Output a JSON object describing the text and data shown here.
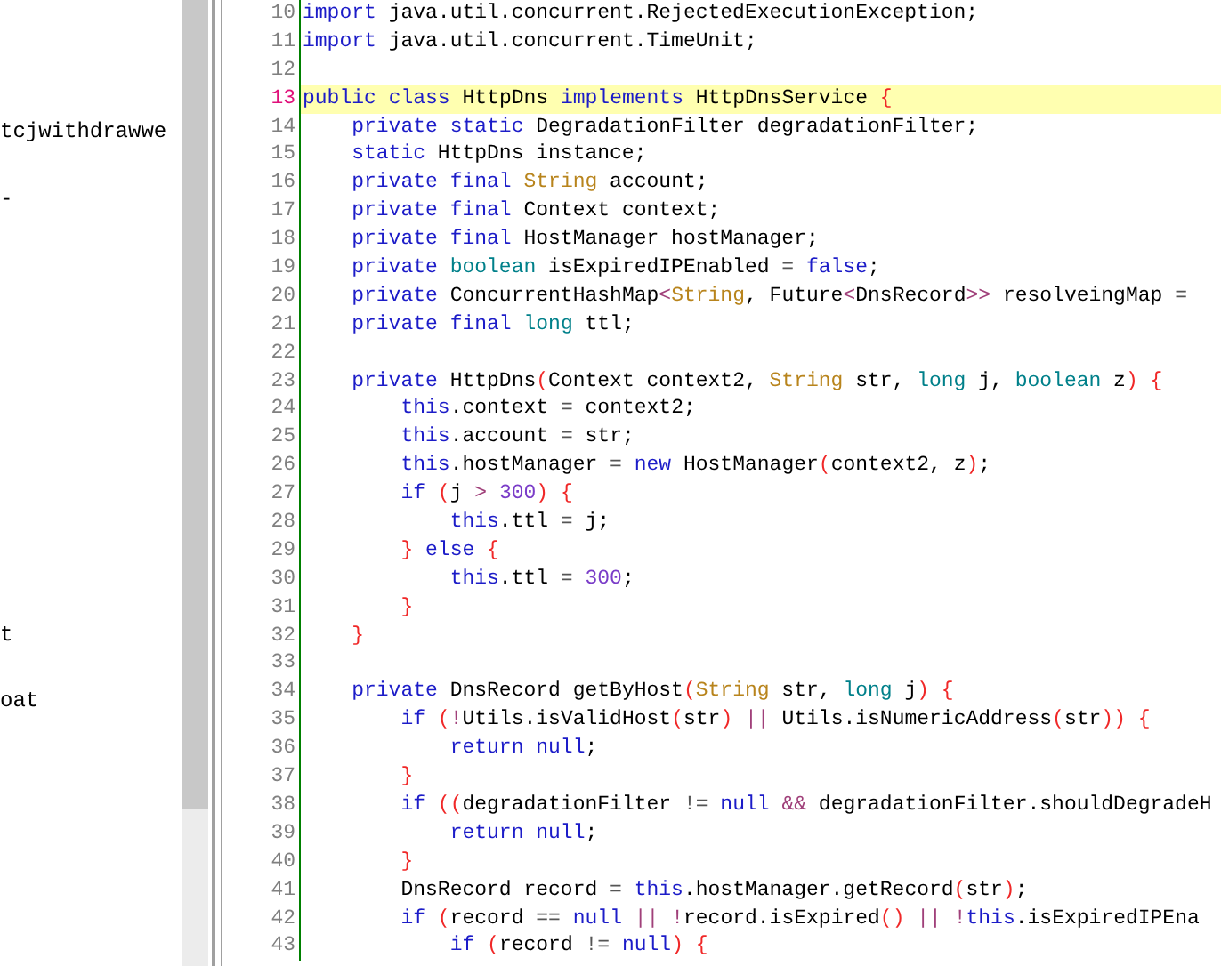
{
  "sidebar": {
    "items": [
      "tcjwithdrawwe",
      "-",
      "t",
      "oat"
    ]
  },
  "editor": {
    "lines": [
      {
        "number": "10",
        "current": false,
        "tokens": [
          {
            "kind": "keyword",
            "text": "import"
          },
          {
            "kind": "plain",
            "text": " java.util.concurrent.RejectedExecutionException;"
          }
        ]
      },
      {
        "number": "11",
        "current": false,
        "tokens": [
          {
            "kind": "keyword",
            "text": "import"
          },
          {
            "kind": "plain",
            "text": " java.util.concurrent.TimeUnit;"
          }
        ]
      },
      {
        "number": "12",
        "current": false
      },
      {
        "number": "13",
        "current": true,
        "tokens": [
          {
            "kind": "keyword",
            "text": "public"
          },
          {
            "kind": "keyword",
            "text": " class"
          },
          {
            "kind": "plain",
            "text": " HttpDns"
          },
          {
            "kind": "keyword",
            "text": " implements"
          },
          {
            "kind": "plain",
            "text": " HttpDnsService"
          },
          {
            "kind": "bracket",
            "text": " {"
          }
        ]
      },
      {
        "number": "14",
        "current": false,
        "tokens": [
          {
            "kind": "keyword",
            "text": "    private"
          },
          {
            "kind": "keyword",
            "text": " static"
          },
          {
            "kind": "plain",
            "text": " DegradationFilter degradationFilter;"
          }
        ]
      },
      {
        "number": "15",
        "current": false,
        "tokens": [
          {
            "kind": "keyword",
            "text": "    static"
          },
          {
            "kind": "plain",
            "text": " HttpDns instance;"
          }
        ]
      },
      {
        "number": "16",
        "current": false,
        "tokens": [
          {
            "kind": "keyword",
            "text": "    private"
          },
          {
            "kind": "keyword",
            "text": " final"
          },
          {
            "kind": "type",
            "text": " String"
          },
          {
            "kind": "plain",
            "text": " account;"
          }
        ]
      },
      {
        "number": "17",
        "current": false,
        "tokens": [
          {
            "kind": "keyword",
            "text": "    private"
          },
          {
            "kind": "keyword",
            "text": " final"
          },
          {
            "kind": "plain",
            "text": " Context context;"
          }
        ]
      },
      {
        "number": "18",
        "current": false,
        "tokens": [
          {
            "kind": "keyword",
            "text": "    private"
          },
          {
            "kind": "keyword",
            "text": " final"
          },
          {
            "kind": "plain",
            "text": " HostManager hostManager;"
          }
        ]
      },
      {
        "number": "19",
        "current": false,
        "tokens": [
          {
            "kind": "keyword",
            "text": "    private"
          },
          {
            "kind": "primitive",
            "text": " boolean"
          },
          {
            "kind": "plain",
            "text": " isExpiredIPEnabled"
          },
          {
            "kind": "operator",
            "text": " ="
          },
          {
            "kind": "keyword",
            "text": " false"
          },
          {
            "kind": "plain",
            "text": ";"
          }
        ]
      },
      {
        "number": "20",
        "current": false,
        "tokens": [
          {
            "kind": "keyword",
            "text": "    private"
          },
          {
            "kind": "plain",
            "text": " ConcurrentHashMap"
          },
          {
            "kind": "generic",
            "text": "<"
          },
          {
            "kind": "type",
            "text": "String"
          },
          {
            "kind": "plain",
            "text": ", Future"
          },
          {
            "kind": "generic",
            "text": "<"
          },
          {
            "kind": "plain",
            "text": "DnsRecord"
          },
          {
            "kind": "generic",
            "text": ">>"
          },
          {
            "kind": "plain",
            "text": " resolveingMap"
          },
          {
            "kind": "operator",
            "text": " ="
          }
        ]
      },
      {
        "number": "21",
        "current": false,
        "tokens": [
          {
            "kind": "keyword",
            "text": "    private"
          },
          {
            "kind": "keyword",
            "text": " final"
          },
          {
            "kind": "primitive",
            "text": " long"
          },
          {
            "kind": "plain",
            "text": " ttl;"
          }
        ]
      },
      {
        "number": "22",
        "current": false
      },
      {
        "number": "23",
        "current": false,
        "tokens": [
          {
            "kind": "keyword",
            "text": "    private"
          },
          {
            "kind": "plain",
            "text": " HttpDns"
          },
          {
            "kind": "bracket",
            "text": "("
          },
          {
            "kind": "plain",
            "text": "Context context2,"
          },
          {
            "kind": "type",
            "text": " String"
          },
          {
            "kind": "plain",
            "text": " str,"
          },
          {
            "kind": "primitive",
            "text": " long"
          },
          {
            "kind": "plain",
            "text": " j,"
          },
          {
            "kind": "primitive",
            "text": " boolean"
          },
          {
            "kind": "plain",
            "text": " z"
          },
          {
            "kind": "bracket",
            "text": ") {"
          }
        ]
      },
      {
        "number": "24",
        "current": false,
        "tokens": [
          {
            "kind": "keyword",
            "text": "        this"
          },
          {
            "kind": "plain",
            "text": ".context"
          },
          {
            "kind": "operator",
            "text": " ="
          },
          {
            "kind": "plain",
            "text": " context2;"
          }
        ]
      },
      {
        "number": "25",
        "current": false,
        "tokens": [
          {
            "kind": "keyword",
            "text": "        this"
          },
          {
            "kind": "plain",
            "text": ".account"
          },
          {
            "kind": "operator",
            "text": " ="
          },
          {
            "kind": "plain",
            "text": " str;"
          }
        ]
      },
      {
        "number": "26",
        "current": false,
        "tokens": [
          {
            "kind": "keyword",
            "text": "        this"
          },
          {
            "kind": "plain",
            "text": ".hostManager"
          },
          {
            "kind": "operator",
            "text": " ="
          },
          {
            "kind": "keyword",
            "text": " new"
          },
          {
            "kind": "plain",
            "text": " HostManager"
          },
          {
            "kind": "bracket",
            "text": "("
          },
          {
            "kind": "plain",
            "text": "context2, z"
          },
          {
            "kind": "bracket",
            "text": ")"
          },
          {
            "kind": "plain",
            "text": ";"
          }
        ]
      },
      {
        "number": "27",
        "current": false,
        "tokens": [
          {
            "kind": "keyword",
            "text": "        if"
          },
          {
            "kind": "bracket",
            "text": " ("
          },
          {
            "kind": "plain",
            "text": "j"
          },
          {
            "kind": "generic",
            "text": " >"
          },
          {
            "kind": "number",
            "text": " 300"
          },
          {
            "kind": "bracket",
            "text": ") {"
          }
        ]
      },
      {
        "number": "28",
        "current": false,
        "tokens": [
          {
            "kind": "keyword",
            "text": "            this"
          },
          {
            "kind": "plain",
            "text": ".ttl"
          },
          {
            "kind": "operator",
            "text": " ="
          },
          {
            "kind": "plain",
            "text": " j;"
          }
        ]
      },
      {
        "number": "29",
        "current": false,
        "tokens": [
          {
            "kind": "bracket",
            "text": "        }"
          },
          {
            "kind": "keyword",
            "text": " else"
          },
          {
            "kind": "bracket",
            "text": " {"
          }
        ]
      },
      {
        "number": "30",
        "current": false,
        "tokens": [
          {
            "kind": "keyword",
            "text": "            this"
          },
          {
            "kind": "plain",
            "text": ".ttl"
          },
          {
            "kind": "operator",
            "text": " ="
          },
          {
            "kind": "number",
            "text": " 300"
          },
          {
            "kind": "plain",
            "text": ";"
          }
        ]
      },
      {
        "number": "31",
        "current": false,
        "tokens": [
          {
            "kind": "bracket",
            "text": "        }"
          }
        ]
      },
      {
        "number": "32",
        "current": false,
        "tokens": [
          {
            "kind": "bracket",
            "text": "    }"
          }
        ]
      },
      {
        "number": "33",
        "current": false
      },
      {
        "number": "34",
        "current": false,
        "tokens": [
          {
            "kind": "keyword",
            "text": "    private"
          },
          {
            "kind": "plain",
            "text": " DnsRecord getByHost"
          },
          {
            "kind": "bracket",
            "text": "("
          },
          {
            "kind": "type",
            "text": "String"
          },
          {
            "kind": "plain",
            "text": " str,"
          },
          {
            "kind": "primitive",
            "text": " long"
          },
          {
            "kind": "plain",
            "text": " j"
          },
          {
            "kind": "bracket",
            "text": ") {"
          }
        ]
      },
      {
        "number": "35",
        "current": false,
        "tokens": [
          {
            "kind": "keyword",
            "text": "        if"
          },
          {
            "kind": "bracket",
            "text": " ("
          },
          {
            "kind": "generic",
            "text": "!"
          },
          {
            "kind": "plain",
            "text": "Utils.isValidHost"
          },
          {
            "kind": "bracket",
            "text": "("
          },
          {
            "kind": "plain",
            "text": "str"
          },
          {
            "kind": "bracket",
            "text": ")"
          },
          {
            "kind": "generic",
            "text": " ||"
          },
          {
            "kind": "plain",
            "text": " Utils.isNumericAddress"
          },
          {
            "kind": "bracket",
            "text": "("
          },
          {
            "kind": "plain",
            "text": "str"
          },
          {
            "kind": "bracket",
            "text": ")) {"
          }
        ]
      },
      {
        "number": "36",
        "current": false,
        "tokens": [
          {
            "kind": "keyword",
            "text": "            return null"
          },
          {
            "kind": "plain",
            "text": ";"
          }
        ]
      },
      {
        "number": "37",
        "current": false,
        "tokens": [
          {
            "kind": "bracket",
            "text": "        }"
          }
        ]
      },
      {
        "number": "38",
        "current": false,
        "tokens": [
          {
            "kind": "keyword",
            "text": "        if"
          },
          {
            "kind": "bracket",
            "text": " (("
          },
          {
            "kind": "plain",
            "text": "degradationFilter"
          },
          {
            "kind": "operator",
            "text": " !="
          },
          {
            "kind": "keyword",
            "text": " null"
          },
          {
            "kind": "generic",
            "text": " &&"
          },
          {
            "kind": "plain",
            "text": " degradationFilter.shouldDegradeH"
          }
        ]
      },
      {
        "number": "39",
        "current": false,
        "tokens": [
          {
            "kind": "keyword",
            "text": "            return null"
          },
          {
            "kind": "plain",
            "text": ";"
          }
        ]
      },
      {
        "number": "40",
        "current": false,
        "tokens": [
          {
            "kind": "bracket",
            "text": "        }"
          }
        ]
      },
      {
        "number": "41",
        "current": false,
        "tokens": [
          {
            "kind": "plain",
            "text": "        DnsRecord record"
          },
          {
            "kind": "operator",
            "text": " ="
          },
          {
            "kind": "keyword",
            "text": " this"
          },
          {
            "kind": "plain",
            "text": ".hostManager.getRecord"
          },
          {
            "kind": "bracket",
            "text": "("
          },
          {
            "kind": "plain",
            "text": "str"
          },
          {
            "kind": "bracket",
            "text": ")"
          },
          {
            "kind": "plain",
            "text": ";"
          }
        ]
      },
      {
        "number": "42",
        "current": false,
        "tokens": [
          {
            "kind": "keyword",
            "text": "        if"
          },
          {
            "kind": "bracket",
            "text": " ("
          },
          {
            "kind": "plain",
            "text": "record"
          },
          {
            "kind": "operator",
            "text": " =="
          },
          {
            "kind": "keyword",
            "text": " null"
          },
          {
            "kind": "generic",
            "text": " || !"
          },
          {
            "kind": "plain",
            "text": "record.isExpired"
          },
          {
            "kind": "bracket",
            "text": "()"
          },
          {
            "kind": "generic",
            "text": " || !"
          },
          {
            "kind": "keyword",
            "text": "this"
          },
          {
            "kind": "plain",
            "text": ".isExpiredIPEna"
          }
        ]
      },
      {
        "number": "43",
        "current": false,
        "tokens": [
          {
            "kind": "keyword",
            "text": "            if"
          },
          {
            "kind": "bracket",
            "text": " ("
          },
          {
            "kind": "plain",
            "text": "record"
          },
          {
            "kind": "operator",
            "text": " !="
          },
          {
            "kind": "keyword",
            "text": " null"
          },
          {
            "kind": "bracket",
            "text": ") {"
          }
        ]
      }
    ]
  }
}
